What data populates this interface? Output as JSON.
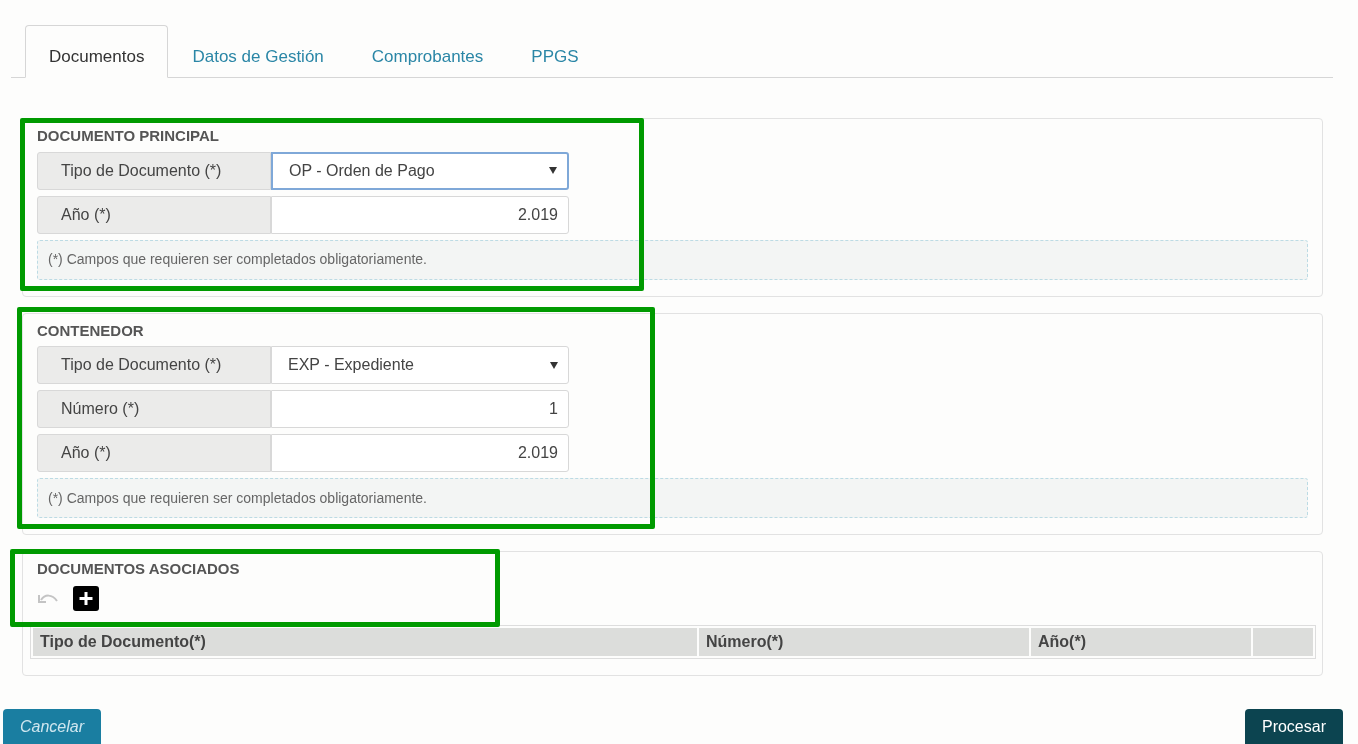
{
  "tabs": [
    {
      "label": "Documentos",
      "selected": true
    },
    {
      "label": "Datos de Gestión",
      "selected": false
    },
    {
      "label": "Comprobantes",
      "selected": false
    },
    {
      "label": "PPGS",
      "selected": false
    }
  ],
  "sections": [
    {
      "title": "DOCUMENTO PRINCIPAL",
      "highlighted": true,
      "fields": [
        {
          "kind": "select",
          "label": "Tipo de Documento (*)",
          "value": "OP - Orden de Pago",
          "focused": true
        },
        {
          "kind": "number",
          "label": "Año (*)",
          "value": "2.019"
        }
      ],
      "note": "(*) Campos que requieren ser completados obligatoriamente."
    },
    {
      "title": "CONTENEDOR",
      "highlighted": true,
      "fields": [
        {
          "kind": "select",
          "label": "Tipo de Documento (*)",
          "value": "EXP - Expediente",
          "focused": false
        },
        {
          "kind": "number",
          "label": "Número (*)",
          "value": "1"
        },
        {
          "kind": "number",
          "label": "Año (*)",
          "value": "2.019"
        }
      ],
      "note": "(*) Campos que requieren ser completados obligatoriamente."
    },
    {
      "title": "DOCUMENTOS ASOCIADOS",
      "highlighted": true,
      "table": {
        "columns": [
          "Tipo de Documento(*)",
          "Número(*)",
          "Año(*)"
        ]
      }
    }
  ],
  "buttons": [
    {
      "kind": "secondary",
      "label": "Cancelar"
    },
    {
      "kind": "primary",
      "label": "Procesar"
    }
  ]
}
